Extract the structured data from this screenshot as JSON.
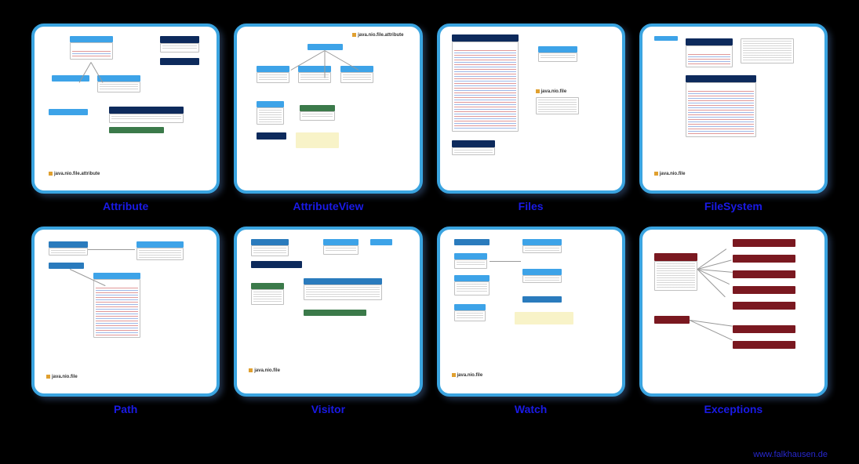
{
  "cards": [
    {
      "caption": "Attribute",
      "package": "java.nio.file.attribute"
    },
    {
      "caption": "AttributeView",
      "package": "java.nio.file.attribute"
    },
    {
      "caption": "Files",
      "package": "java.nio.file"
    },
    {
      "caption": "FileSystem",
      "package": "java.nio.file"
    },
    {
      "caption": "Path",
      "package": "java.nio.file"
    },
    {
      "caption": "Visitor",
      "package": "java.nio.file"
    },
    {
      "caption": "Watch",
      "package": "java.nio.file"
    },
    {
      "caption": "Exceptions",
      "package": ""
    }
  ],
  "footer": "www.falkhausen.de"
}
